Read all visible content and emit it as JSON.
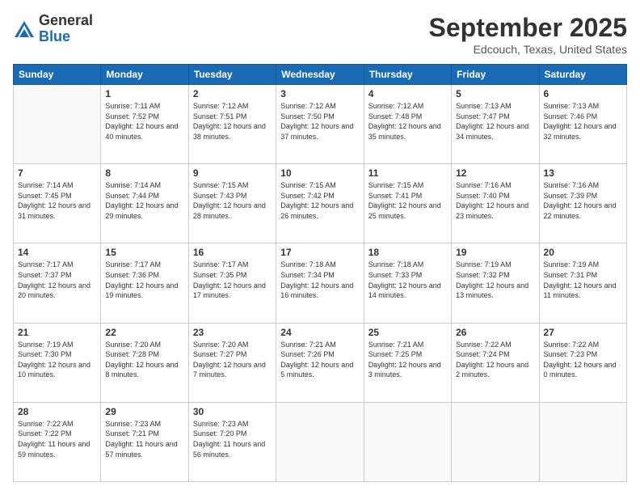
{
  "header": {
    "logo_general": "General",
    "logo_blue": "Blue",
    "month_title": "September 2025",
    "location": "Edcouch, Texas, United States"
  },
  "days_of_week": [
    "Sunday",
    "Monday",
    "Tuesday",
    "Wednesday",
    "Thursday",
    "Friday",
    "Saturday"
  ],
  "weeks": [
    [
      {
        "day": "",
        "empty": true
      },
      {
        "day": "1",
        "sunrise": "7:11 AM",
        "sunset": "7:52 PM",
        "daylight": "12 hours and 40 minutes."
      },
      {
        "day": "2",
        "sunrise": "7:12 AM",
        "sunset": "7:51 PM",
        "daylight": "12 hours and 38 minutes."
      },
      {
        "day": "3",
        "sunrise": "7:12 AM",
        "sunset": "7:50 PM",
        "daylight": "12 hours and 37 minutes."
      },
      {
        "day": "4",
        "sunrise": "7:12 AM",
        "sunset": "7:48 PM",
        "daylight": "12 hours and 35 minutes."
      },
      {
        "day": "5",
        "sunrise": "7:13 AM",
        "sunset": "7:47 PM",
        "daylight": "12 hours and 34 minutes."
      },
      {
        "day": "6",
        "sunrise": "7:13 AM",
        "sunset": "7:46 PM",
        "daylight": "12 hours and 32 minutes."
      }
    ],
    [
      {
        "day": "7",
        "sunrise": "7:14 AM",
        "sunset": "7:45 PM",
        "daylight": "12 hours and 31 minutes."
      },
      {
        "day": "8",
        "sunrise": "7:14 AM",
        "sunset": "7:44 PM",
        "daylight": "12 hours and 29 minutes."
      },
      {
        "day": "9",
        "sunrise": "7:15 AM",
        "sunset": "7:43 PM",
        "daylight": "12 hours and 28 minutes."
      },
      {
        "day": "10",
        "sunrise": "7:15 AM",
        "sunset": "7:42 PM",
        "daylight": "12 hours and 26 minutes."
      },
      {
        "day": "11",
        "sunrise": "7:15 AM",
        "sunset": "7:41 PM",
        "daylight": "12 hours and 25 minutes."
      },
      {
        "day": "12",
        "sunrise": "7:16 AM",
        "sunset": "7:40 PM",
        "daylight": "12 hours and 23 minutes."
      },
      {
        "day": "13",
        "sunrise": "7:16 AM",
        "sunset": "7:39 PM",
        "daylight": "12 hours and 22 minutes."
      }
    ],
    [
      {
        "day": "14",
        "sunrise": "7:17 AM",
        "sunset": "7:37 PM",
        "daylight": "12 hours and 20 minutes."
      },
      {
        "day": "15",
        "sunrise": "7:17 AM",
        "sunset": "7:36 PM",
        "daylight": "12 hours and 19 minutes."
      },
      {
        "day": "16",
        "sunrise": "7:17 AM",
        "sunset": "7:35 PM",
        "daylight": "12 hours and 17 minutes."
      },
      {
        "day": "17",
        "sunrise": "7:18 AM",
        "sunset": "7:34 PM",
        "daylight": "12 hours and 16 minutes."
      },
      {
        "day": "18",
        "sunrise": "7:18 AM",
        "sunset": "7:33 PM",
        "daylight": "12 hours and 14 minutes."
      },
      {
        "day": "19",
        "sunrise": "7:19 AM",
        "sunset": "7:32 PM",
        "daylight": "12 hours and 13 minutes."
      },
      {
        "day": "20",
        "sunrise": "7:19 AM",
        "sunset": "7:31 PM",
        "daylight": "12 hours and 11 minutes."
      }
    ],
    [
      {
        "day": "21",
        "sunrise": "7:19 AM",
        "sunset": "7:30 PM",
        "daylight": "12 hours and 10 minutes."
      },
      {
        "day": "22",
        "sunrise": "7:20 AM",
        "sunset": "7:28 PM",
        "daylight": "12 hours and 8 minutes."
      },
      {
        "day": "23",
        "sunrise": "7:20 AM",
        "sunset": "7:27 PM",
        "daylight": "12 hours and 7 minutes."
      },
      {
        "day": "24",
        "sunrise": "7:21 AM",
        "sunset": "7:26 PM",
        "daylight": "12 hours and 5 minutes."
      },
      {
        "day": "25",
        "sunrise": "7:21 AM",
        "sunset": "7:25 PM",
        "daylight": "12 hours and 3 minutes."
      },
      {
        "day": "26",
        "sunrise": "7:22 AM",
        "sunset": "7:24 PM",
        "daylight": "12 hours and 2 minutes."
      },
      {
        "day": "27",
        "sunrise": "7:22 AM",
        "sunset": "7:23 PM",
        "daylight": "12 hours and 0 minutes."
      }
    ],
    [
      {
        "day": "28",
        "sunrise": "7:22 AM",
        "sunset": "7:22 PM",
        "daylight": "11 hours and 59 minutes."
      },
      {
        "day": "29",
        "sunrise": "7:23 AM",
        "sunset": "7:21 PM",
        "daylight": "11 hours and 57 minutes."
      },
      {
        "day": "30",
        "sunrise": "7:23 AM",
        "sunset": "7:20 PM",
        "daylight": "11 hours and 56 minutes."
      },
      {
        "day": "",
        "empty": true
      },
      {
        "day": "",
        "empty": true
      },
      {
        "day": "",
        "empty": true
      },
      {
        "day": "",
        "empty": true
      }
    ]
  ]
}
